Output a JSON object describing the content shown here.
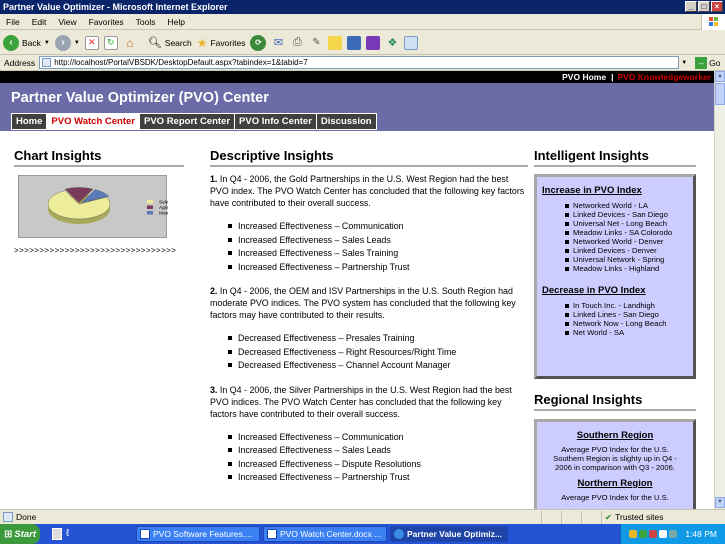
{
  "window": {
    "title": "Partner Value Optimizer - Microsoft Internet Explorer"
  },
  "menu": [
    "File",
    "Edit",
    "View",
    "Favorites",
    "Tools",
    "Help"
  ],
  "toolbar": {
    "back": "Back",
    "search": "Search",
    "favorites": "Favorites"
  },
  "address": {
    "label": "Address",
    "url": "http://localhost/PortalVBSDK/DesktopDefault.aspx?tabindex=1&tabid=7",
    "go": "Go"
  },
  "portal": {
    "top_links": {
      "home": "PVO Home",
      "user": "PVO Knowledgeworker"
    },
    "title": "Partner Value Optimizer (PVO) Center",
    "tabs": [
      "Home",
      "PVO Watch Center",
      "PVO Report Center",
      "PVO Info Center",
      "Discussion"
    ]
  },
  "chart_insights": {
    "heading": "Chart Insights",
    "arrows": ">>>>>>>>>>>>>>>>>>>>>>>>>>>>>>>>"
  },
  "chart_data": {
    "type": "pie",
    "title": "",
    "labels": [
      "Selection",
      "Agreement",
      "Management"
    ],
    "values": [
      75,
      15,
      10
    ],
    "colors": [
      "#ecec9a",
      "#7a3a5a",
      "#5a7ab8"
    ]
  },
  "descriptive": {
    "heading": "Descriptive Insights",
    "items": [
      {
        "num": "1.",
        "text": "In Q4 - 2006, the Gold Partnerships in the U.S. West Region had the best PVO index. The PVO Watch Center has concluded that the following key factors have contributed to their overall success.",
        "factors": [
          "Increased Effectiveness – Communication",
          "Increased Effectiveness – Sales Leads",
          "Increased Effectiveness – Sales Training",
          "Increased Effectiveness – Partnership Trust"
        ]
      },
      {
        "num": "2.",
        "text": "In Q4 - 2006, the OEM and ISV Partnerships in the U.S. South Region had moderate PVO indices. The PVO system has concluded that the following key factors may have contributed to their results.",
        "factors": [
          "Decreased Effectiveness – Presales Training",
          "Decreased Effectiveness – Right Resources/Right Time",
          "Decreased Effectiveness – Channel Account Manager"
        ]
      },
      {
        "num": "3.",
        "text": "In Q4 - 2006, the Silver Partnerships in the U.S. West Region had the best PVO indices. The PVO Watch Center has concluded that the following key factors have contributed to their overall success.",
        "factors": [
          "Increased Effectiveness – Communication",
          "Increased Effectiveness – Sales Leads",
          "Increased Effectiveness – Dispute Resolutions",
          "Increased Effectiveness – Partnership Trust"
        ]
      }
    ]
  },
  "intelligent": {
    "heading": "Intelligent Insights",
    "increase_title": "Increase in PVO Index",
    "increase": [
      "Networked World - LA",
      "Linked Devices - San Diego",
      "Universal Net - Long Beach",
      "Meadow Links - SA Colorodo",
      "Networked World - Denver",
      "Linked Devices - Denver",
      "Universal Network - Spring",
      "Meadow Links - Highland"
    ],
    "decrease_title": "Decrease in PVO Index",
    "decrease": [
      "In Touch Inc. - Landhigh",
      "Linked Lines - San Diego",
      "Network Now - Long Beach",
      "Net World - SA"
    ]
  },
  "regional": {
    "heading": "Regional Insights",
    "southern_title": "Southern Region",
    "southern_text": "Average PVO Index for the U.S. Southern Region is slighty up in Q4 - 2006 in comparison with Q3 - 2006.",
    "northern_title": "Northern Region",
    "northern_text": "Average PVO Index for the U.S."
  },
  "status": {
    "left": "Done",
    "zone": "Trusted sites"
  },
  "taskbar": {
    "start": "Start",
    "tasks": [
      "PVO Software Features....",
      "PVO Watch Center.docx ...",
      "Partner Value Optimiz..."
    ],
    "time": "1:48 PM"
  }
}
